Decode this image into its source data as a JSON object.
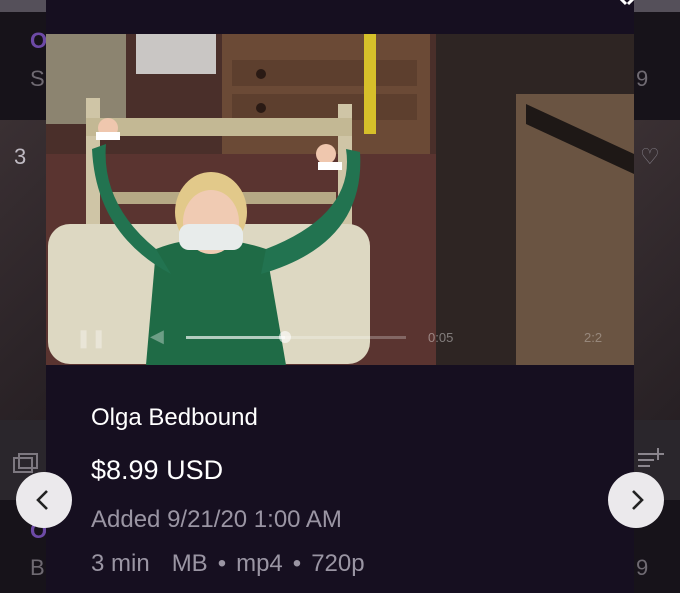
{
  "background": {
    "top_letter": "O",
    "s_letter": "S",
    "count_3": "3",
    "right_9_top": "9",
    "b_letter": "B",
    "right_9_bottom": "9"
  },
  "video": {
    "current_time": "0:05",
    "total_time": "2:2",
    "progress": 0.45
  },
  "product": {
    "title": "Olga Bedbound",
    "price": "$8.99 USD",
    "added": "Added 9/21/20 1:00 AM",
    "duration": "3 min",
    "size": "MB",
    "format": "mp4",
    "resolution": "720p",
    "separator": "•"
  },
  "colors": {
    "modal_bg": "#160f20",
    "secondary_text": "#9a95a3",
    "nav_button_bg": "#ebe9ec"
  },
  "icons": [
    "close-icon",
    "play-icon",
    "volume-icon",
    "chevron-left-icon",
    "chevron-right-icon",
    "heart-icon",
    "gallery-icon",
    "add-list-icon"
  ]
}
